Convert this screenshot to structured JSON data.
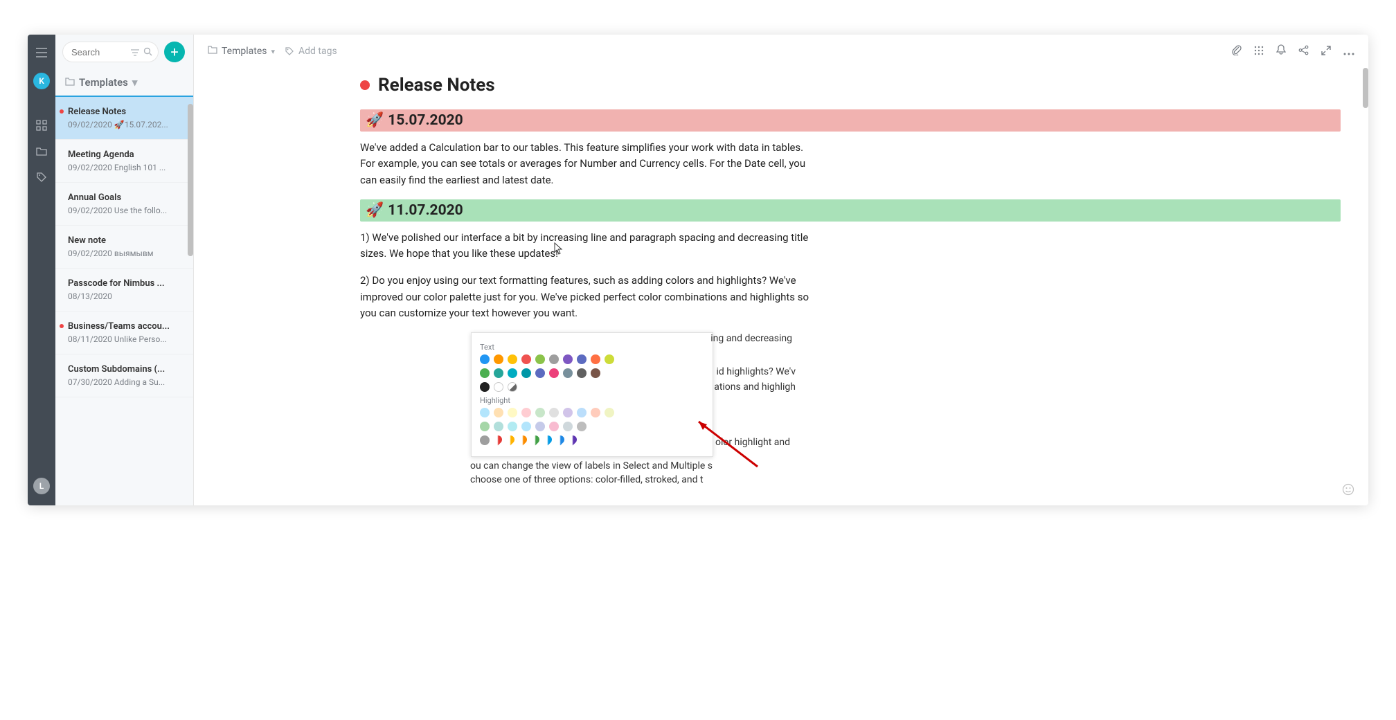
{
  "search": {
    "placeholder": "Search"
  },
  "folder": {
    "name": "Templates"
  },
  "breadcrumb": {
    "folder": "Templates",
    "addTags": "Add tags"
  },
  "notes": [
    {
      "title": "Release Notes",
      "meta": "09/02/2020 🚀15.07.202...",
      "selected": true,
      "dot": true
    },
    {
      "title": "Meeting Agenda",
      "meta": "09/02/2020 English 101 ...",
      "selected": false,
      "dot": false
    },
    {
      "title": "Annual Goals",
      "meta": "09/02/2020 Use the follo...",
      "selected": false,
      "dot": false
    },
    {
      "title": "New note",
      "meta": "09/02/2020 выямывм",
      "selected": false,
      "dot": false
    },
    {
      "title": "Passcode for Nimbus ...",
      "meta": "08/13/2020",
      "selected": false,
      "dot": false
    },
    {
      "title": "Business/Teams accou...",
      "meta": "08/11/2020 Unlike Perso...",
      "selected": false,
      "dot": true
    },
    {
      "title": "Custom Subdomains (...",
      "meta": "07/30/2020 Adding a Su...",
      "selected": false,
      "dot": false
    }
  ],
  "document": {
    "title": "Release Notes",
    "blocks": {
      "date1": "15.07.2020",
      "para1": "We've added a Calculation bar to our tables. This feature simplifies your work with data in tables. For example, you can see totals or averages for Number and Currency cells. For the Date cell, you can easily find the earliest and latest date.",
      "date2": "11.07.2020",
      "para2": "1) We've polished our interface a bit by increasing line and paragraph spacing and decreasing title sizes. We hope that you like these updates!",
      "para3": "2) Do you enjoy using our text formatting features, such as adding colors and highlights? We've improved our color palette just for you. We've picked perfect color combinations and highlights so you can customize your text however you want."
    }
  },
  "palette": {
    "textLabel": "Text",
    "highlightLabel": "Highlight",
    "bgText1": "ing and decreasing",
    "bgText2": "id highlights? We'v",
    "bgText3": "ations and highligh",
    "bgText4": "olor highlight and",
    "bgText5": "ou can change the view of labels in Select and Multiple s",
    "bgText6": "choose one of three options: color-filled, stroked, and t",
    "textColors1": [
      "#2196f3",
      "#ff9800",
      "#ffc107",
      "#ef5350",
      "#8bc34a",
      "#9e9e9e",
      "#7e57c2",
      "#5c6bc0",
      "#ff7043",
      "#cddc39"
    ],
    "textColors2": [
      "#4caf50",
      "#26a69a",
      "#00acc1",
      "#0097a7",
      "#5c6bc0",
      "#ec407a",
      "#78909c",
      "#616161",
      "#795548"
    ],
    "textColors3": [
      "#212121",
      "#ffffff"
    ],
    "highlightColors1": [
      "#b3e5fc",
      "#ffe0b2",
      "#fff9c4",
      "#ffcdd2",
      "#c8e6c9",
      "#e0e0e0",
      "#d1c4e9",
      "#bbdefb",
      "#ffccbc",
      "#f0f4c3"
    ],
    "highlightColors2": [
      "#a5d6a7",
      "#b2dfdb",
      "#b2ebf2",
      "#b3e5fc",
      "#c5cae9",
      "#f8bbd0",
      "#cfd8dc",
      "#bdbdbd"
    ],
    "highlightColors3": [
      "#9e9e9e",
      "#e53935",
      "#ffb300",
      "#fb8c00",
      "#43a047",
      "#039be5",
      "#1e88e5",
      "#5e35b1"
    ]
  }
}
